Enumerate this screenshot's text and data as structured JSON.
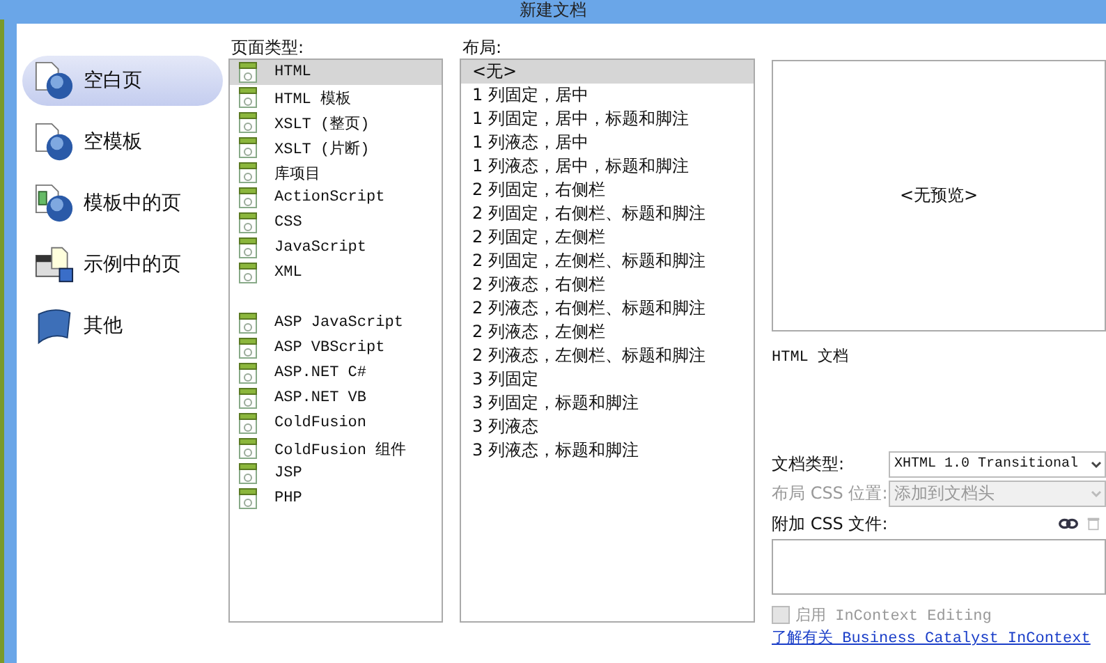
{
  "window": {
    "title": "新建文档"
  },
  "categories": [
    {
      "label": "空白页",
      "kind": "blank",
      "selected": true
    },
    {
      "label": "空模板",
      "kind": "template",
      "selected": false
    },
    {
      "label": "模板中的页",
      "kind": "from-template",
      "selected": false
    },
    {
      "label": "示例中的页",
      "kind": "sample",
      "selected": false
    },
    {
      "label": "其他",
      "kind": "other",
      "selected": false
    }
  ],
  "page_types": {
    "heading": "页面类型:",
    "groups": [
      [
        {
          "label": "HTML",
          "selected": true
        },
        {
          "label": "HTML 模板",
          "selected": false
        },
        {
          "label": "XSLT (整页)",
          "selected": false
        },
        {
          "label": "XSLT (片断)",
          "selected": false
        },
        {
          "label": "库项目",
          "selected": false
        },
        {
          "label": "ActionScript",
          "selected": false
        },
        {
          "label": "CSS",
          "selected": false
        },
        {
          "label": "JavaScript",
          "selected": false
        },
        {
          "label": "XML",
          "selected": false
        }
      ],
      [
        {
          "label": "ASP JavaScript",
          "selected": false
        },
        {
          "label": "ASP VBScript",
          "selected": false
        },
        {
          "label": "ASP.NET C#",
          "selected": false
        },
        {
          "label": "ASP.NET VB",
          "selected": false
        },
        {
          "label": "ColdFusion",
          "selected": false
        },
        {
          "label": "ColdFusion 组件",
          "selected": false
        },
        {
          "label": "JSP",
          "selected": false
        },
        {
          "label": "PHP",
          "selected": false
        }
      ]
    ]
  },
  "layouts": {
    "heading": "布局:",
    "items": [
      {
        "label": "<无>",
        "selected": true
      },
      {
        "label": "1 列固定，居中",
        "selected": false
      },
      {
        "label": "1 列固定，居中，标题和脚注",
        "selected": false
      },
      {
        "label": "1 列液态，居中",
        "selected": false
      },
      {
        "label": "1 列液态，居中，标题和脚注",
        "selected": false
      },
      {
        "label": "2 列固定，右侧栏",
        "selected": false
      },
      {
        "label": "2 列固定，右侧栏、标题和脚注",
        "selected": false
      },
      {
        "label": "2 列固定，左侧栏",
        "selected": false
      },
      {
        "label": "2 列固定，左侧栏、标题和脚注",
        "selected": false
      },
      {
        "label": "2 列液态，右侧栏",
        "selected": false
      },
      {
        "label": "2 列液态，右侧栏、标题和脚注",
        "selected": false
      },
      {
        "label": "2 列液态，左侧栏",
        "selected": false
      },
      {
        "label": "2 列液态，左侧栏、标题和脚注",
        "selected": false
      },
      {
        "label": "3 列固定",
        "selected": false
      },
      {
        "label": "3 列固定，标题和脚注",
        "selected": false
      },
      {
        "label": "3 列液态",
        "selected": false
      },
      {
        "label": "3 列液态，标题和脚注",
        "selected": false
      }
    ]
  },
  "preview": {
    "text": "<无预览>"
  },
  "description": "HTML 文档",
  "doc_type": {
    "label": "文档类型:",
    "value": "XHTML 1.0 Transitional",
    "disabled": false
  },
  "layout_css": {
    "label": "布局 CSS 位置:",
    "value": "添加到文档头",
    "disabled": true
  },
  "attach_css": {
    "label": "附加 CSS 文件:"
  },
  "incontext": {
    "label": "启用 InContext Editing",
    "checked": false,
    "disabled": true
  },
  "link": "了解有关 Business Catalyst InContext"
}
